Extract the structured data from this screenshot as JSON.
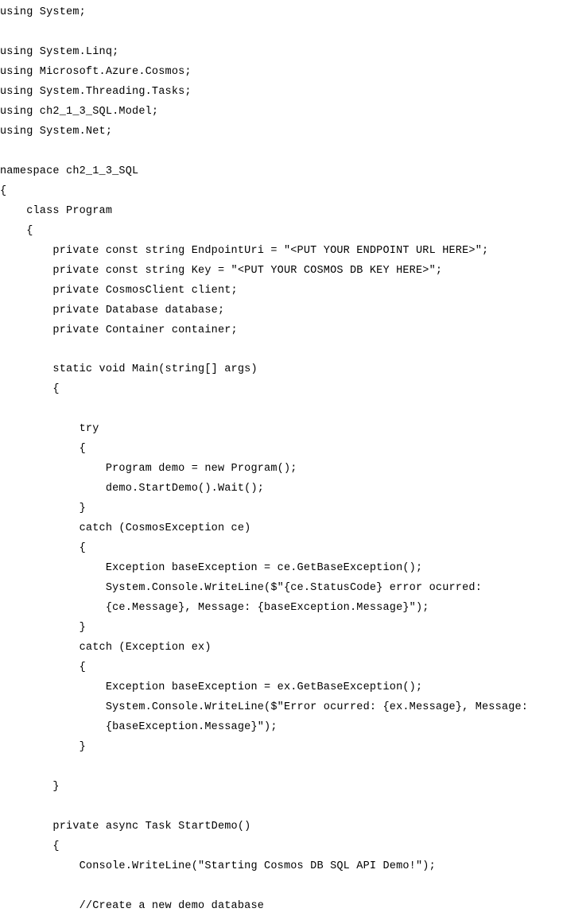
{
  "code": {
    "lines": [
      "using System;",
      "",
      "using System.Linq;",
      "using Microsoft.Azure.Cosmos;",
      "using System.Threading.Tasks;",
      "using ch2_1_3_SQL.Model;",
      "using System.Net;",
      "",
      "namespace ch2_1_3_SQL",
      "{",
      "    class Program",
      "    {",
      "        private const string EndpointUri = \"<PUT YOUR ENDPOINT URL HERE>\";",
      "        private const string Key = \"<PUT YOUR COSMOS DB KEY HERE>\";",
      "        private CosmosClient client;",
      "        private Database database;",
      "        private Container container;",
      "",
      "        static void Main(string[] args)",
      "        {",
      "",
      "            try",
      "            {",
      "                Program demo = new Program();",
      "                demo.StartDemo().Wait();",
      "            }",
      "            catch (CosmosException ce)",
      "            {",
      "                Exception baseException = ce.GetBaseException();",
      "                System.Console.WriteLine($\"{ce.StatusCode} error ocurred:",
      "                {ce.Message}, Message: {baseException.Message}\");",
      "            }",
      "            catch (Exception ex)",
      "            {",
      "                Exception baseException = ex.GetBaseException();",
      "                System.Console.WriteLine($\"Error ocurred: {ex.Message}, Message:",
      "                {baseException.Message}\");",
      "            }",
      "",
      "        }",
      "",
      "        private async Task StartDemo()",
      "        {",
      "            Console.WriteLine(\"Starting Cosmos DB SQL API Demo!\");",
      "",
      "            //Create a new demo database"
    ]
  }
}
